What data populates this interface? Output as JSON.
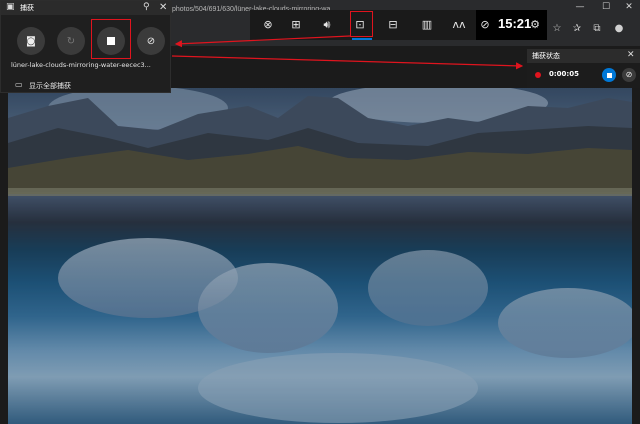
{
  "browser": {
    "url_text": "photos/504/691/630/lüner-lake-clouds-mirroring-wa",
    "controls": [
      "—",
      "☐",
      "✕"
    ]
  },
  "capture_widget": {
    "title": "捕获",
    "filename": "lüner-lake-clouds-mirroring-water-eecec3...",
    "show_all_label": "显示全部捕获"
  },
  "gamebar": {
    "time": "15:21"
  },
  "status_widget": {
    "title": "捕获状态",
    "timer": "0:00:05"
  },
  "colors": {
    "highlight": "#e0141e",
    "accent": "#0078d7"
  },
  "icons": [
    "camera-icon",
    "replay-icon",
    "stop-record-icon",
    "mic-off-icon",
    "pin-icon",
    "close-icon",
    "xbox-icon",
    "controller-icon",
    "audio-icon",
    "capture-icon",
    "performance-icon",
    "resources-icon",
    "social-icon",
    "settings-icon"
  ]
}
